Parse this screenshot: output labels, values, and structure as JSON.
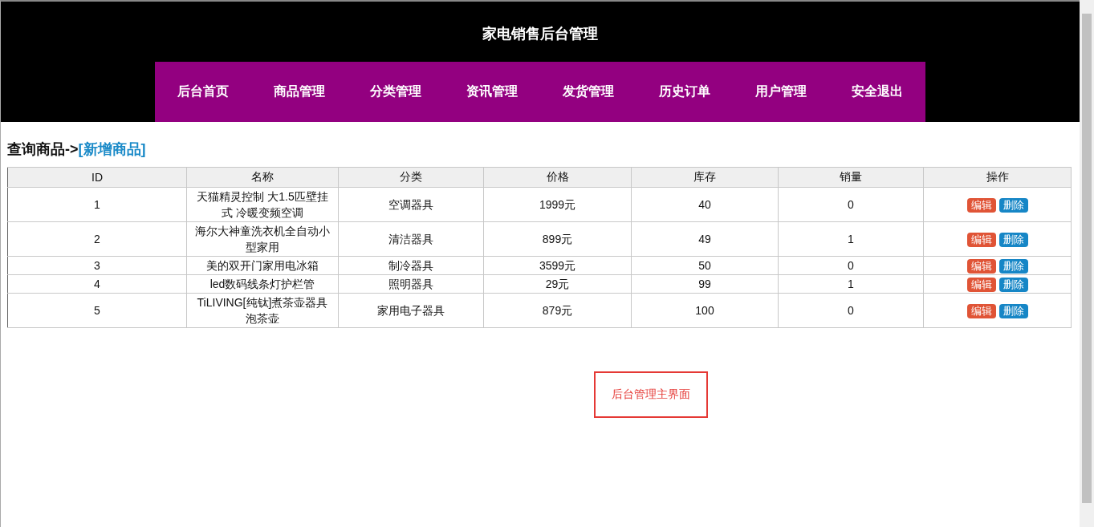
{
  "header": {
    "title": "家电销售后台管理"
  },
  "nav": [
    {
      "label": "后台首页"
    },
    {
      "label": "商品管理"
    },
    {
      "label": "分类管理"
    },
    {
      "label": "资讯管理"
    },
    {
      "label": "发货管理"
    },
    {
      "label": "历史订单"
    },
    {
      "label": "用户管理"
    },
    {
      "label": "安全退出"
    }
  ],
  "breadcrumb": {
    "current": "查询商品->",
    "link": "[新增商品]"
  },
  "table": {
    "columns": [
      "ID",
      "名称",
      "分类",
      "价格",
      "库存",
      "销量",
      "操作"
    ],
    "rows": [
      {
        "cells": [
          "1",
          "天猫精灵控制 大1.5匹壁挂式 冷暖变频空调",
          "空调器具",
          "1999元",
          "40",
          "0"
        ],
        "actions": [
          {
            "label": "编辑",
            "kind": "edit"
          },
          {
            "label": "删除",
            "kind": "delete"
          }
        ]
      },
      {
        "cells": [
          "2",
          "海尔大神童洗衣机全自动小型家用",
          "清洁器具",
          "899元",
          "49",
          "1"
        ],
        "actions": [
          {
            "label": "编辑",
            "kind": "edit"
          },
          {
            "label": "删除",
            "kind": "delete"
          }
        ]
      },
      {
        "cells": [
          "3",
          "美的双开门家用电冰箱",
          "制冷器具",
          "3599元",
          "50",
          "0"
        ],
        "actions": [
          {
            "label": "编辑",
            "kind": "edit"
          },
          {
            "label": "删除",
            "kind": "delete"
          }
        ]
      },
      {
        "cells": [
          "4",
          "led数码线条灯护栏管",
          "照明器具",
          "29元",
          "99",
          "1"
        ],
        "actions": [
          {
            "label": "编辑",
            "kind": "edit"
          },
          {
            "label": "删除",
            "kind": "delete"
          }
        ]
      },
      {
        "cells": [
          "5",
          "TiLIVING[纯钛]煮茶壶器具泡茶壶",
          "家用电子器具",
          "879元",
          "100",
          "0"
        ],
        "actions": [
          {
            "label": "编辑",
            "kind": "edit"
          },
          {
            "label": "删除",
            "kind": "delete"
          }
        ]
      }
    ]
  },
  "caption": "后台管理主界面"
}
